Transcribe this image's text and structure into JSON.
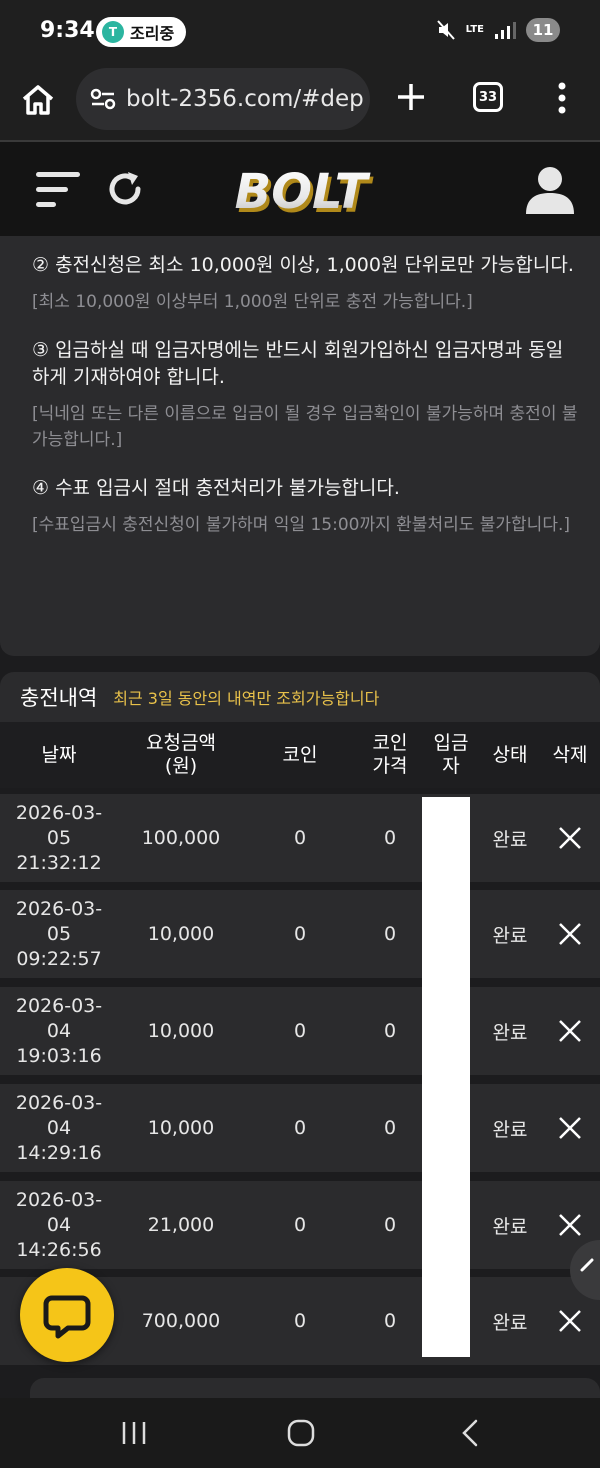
{
  "status_bar": {
    "time": "9:34",
    "pill_icon_text": "T",
    "pill_text": "조리중",
    "network": "LTE",
    "battery": "11"
  },
  "browser": {
    "url": "bolt-2356.com/#dep",
    "tab_count": "33"
  },
  "app": {
    "logo_text": "BOLT"
  },
  "notices": [
    {
      "main": "② 충전신청은 최소 10,000원 이상, 1,000원 단위로만 가능합니다.",
      "sub": "[최소 10,000원 이상부터 1,000원 단위로 충전 가능합니다.]"
    },
    {
      "main": "③ 입금하실 때 입금자명에는 반드시 회원가입하신 입금자명과 동일하게 기재하여야 합니다.",
      "sub": "[닉네임 또는 다른 이름으로 입금이 될 경우 입금확인이 불가능하며 충전이 불가능합니다.]"
    },
    {
      "main": "④ 수표 입금시 절대 충전처리가 불가능합니다.",
      "sub": "[수표입금시 충전신청이 불가하며 익일 15:00까지 환불처리도 불가합니다.]"
    }
  ],
  "history": {
    "title": "충전내역",
    "subtitle": "최근 3일 동안의 내역만 조회가능합니다",
    "columns": {
      "date": "날짜",
      "amount_1": "요청금액",
      "amount_2": "(원)",
      "coin": "코인",
      "price_1": "코인",
      "price_2": "가격",
      "depositor_1": "입금",
      "depositor_2": "자",
      "status": "상태",
      "delete": "삭제"
    },
    "rows": [
      {
        "date_1": "2026-03-",
        "date_2": "05",
        "date_3": "21:32:12",
        "amount": "100,000",
        "coin": "0",
        "price": "0",
        "status": "완료"
      },
      {
        "date_1": "2026-03-",
        "date_2": "05",
        "date_3": "09:22:57",
        "amount": "10,000",
        "coin": "0",
        "price": "0",
        "status": "완료"
      },
      {
        "date_1": "2026-03-",
        "date_2": "04",
        "date_3": "19:03:16",
        "amount": "10,000",
        "coin": "0",
        "price": "0",
        "status": "완료"
      },
      {
        "date_1": "2026-03-",
        "date_2": "04",
        "date_3": "14:29:16",
        "amount": "10,000",
        "coin": "0",
        "price": "0",
        "status": "완료"
      },
      {
        "date_1": "2026-03-",
        "date_2": "04",
        "date_3": "14:26:56",
        "amount": "21,000",
        "coin": "0",
        "price": "0",
        "status": "완료"
      },
      {
        "date_1": "2",
        "date_2": "",
        "date_3": "1",
        "amount": "700,000",
        "coin": "0",
        "price": "0",
        "status": "완료"
      }
    ]
  },
  "colors": {
    "accent_yellow": "#f5c518",
    "subtitle_yellow": "#e8c14a",
    "card_bg": "#2b2b2d",
    "page_bg": "#1c1c1e"
  },
  "icons": {
    "home": "home-icon",
    "tune": "site-info-icon",
    "plus": "new-tab-icon",
    "menu": "more-vert-icon",
    "hamburger": "hamburger-menu-icon",
    "refresh": "refresh-icon",
    "user": "user-icon",
    "delete": "close-icon",
    "chat": "chat-icon"
  }
}
